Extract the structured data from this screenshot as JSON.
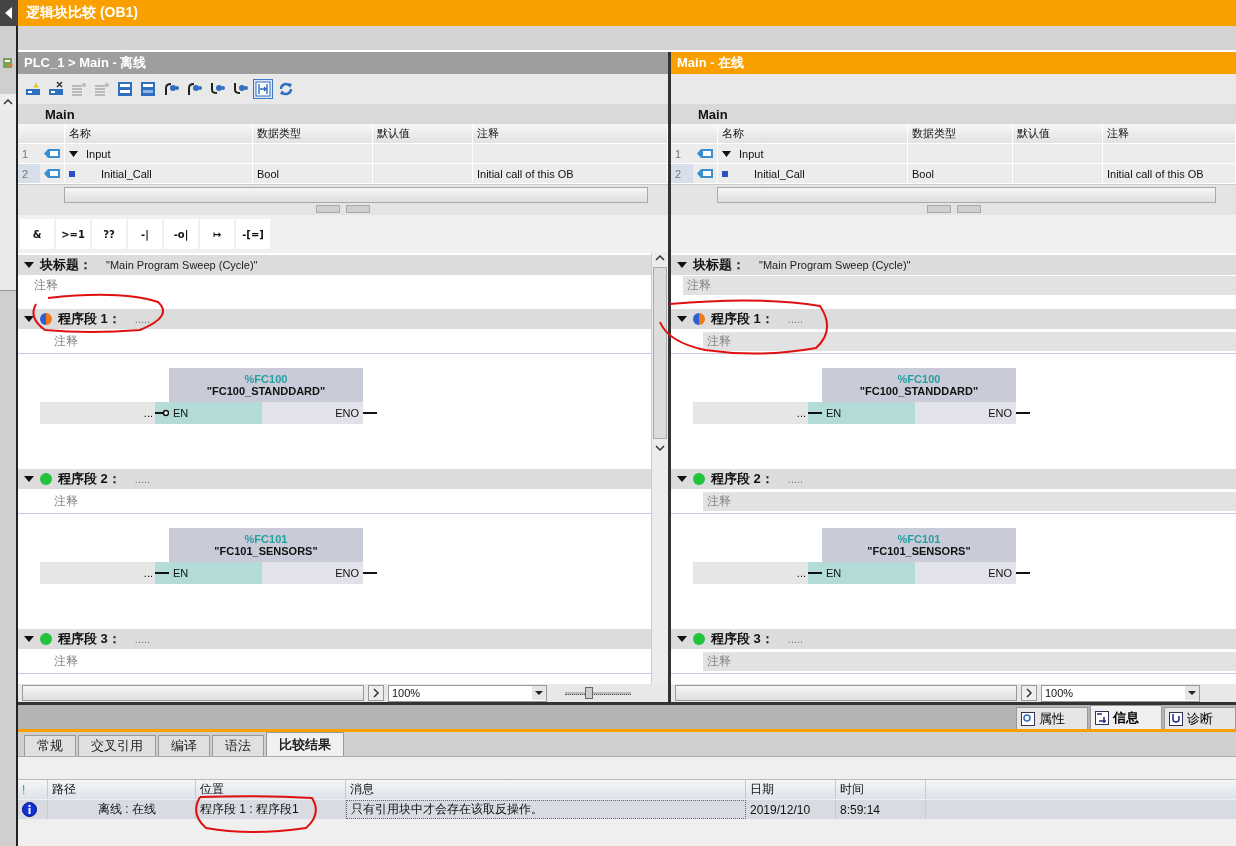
{
  "window": {
    "title": "逻辑块比较 (OB1)"
  },
  "panes": [
    {
      "kind": "offline",
      "title": "PLC_1 > Main - 离线",
      "toolbar": true,
      "vscroll": true,
      "palette": [
        "&",
        ">=1",
        "??",
        "-|",
        "-o|",
        "↦",
        "-[=]"
      ],
      "interface": {
        "name": "Main",
        "columns": [
          "名称",
          "数据类型",
          "默认值",
          "注释"
        ],
        "rows": [
          {
            "index": "1",
            "name": "Input",
            "expanded": true,
            "children": [
              {
                "index": "2",
                "name": "Initial_Call",
                "data_type": "Bool",
                "comment": "Initial call of this OB"
              }
            ]
          }
        ]
      },
      "block_title": {
        "label": "块标题：",
        "value": "\"Main Program Sweep (Cycle)\"",
        "comment": "注释"
      },
      "networks": [
        {
          "label": "程序段 1：",
          "title": ".....",
          "identical": false,
          "comment": "注释",
          "block": {
            "address": "%FC100",
            "name": "\"FC100_STANDDARD\"",
            "wire": "...",
            "input": "EN",
            "output": "ENO",
            "negated": true
          }
        },
        {
          "label": "程序段 2：",
          "title": ".....",
          "identical": true,
          "comment": "注释",
          "block": {
            "address": "%FC101",
            "name": "\"FC101_SENSORS\"",
            "wire": "...",
            "input": "EN",
            "output": "ENO",
            "negated": false
          }
        },
        {
          "label": "程序段 3：",
          "title": ".....",
          "identical": true,
          "comment": "注释"
        }
      ],
      "zoom": "100%",
      "zoom_slider": {
        "level": 0.35
      }
    },
    {
      "kind": "online",
      "title": "Main - 在线",
      "toolbar": false,
      "vscroll": false,
      "interface": {
        "name": "Main",
        "columns": [
          "名称",
          "数据类型",
          "默认值",
          "注释"
        ],
        "rows": [
          {
            "index": "1",
            "name": "Input",
            "expanded": true,
            "children": [
              {
                "index": "2",
                "name": "Initial_Call",
                "data_type": "Bool",
                "comment": "Initial call of this OB"
              }
            ]
          }
        ]
      },
      "block_title": {
        "label": "块标题：",
        "value": "\"Main Program Sweep (Cycle)\"",
        "comment": "注释"
      },
      "networks": [
        {
          "label": "程序段 1：",
          "title": ".....",
          "identical": false,
          "comment": "注释",
          "block": {
            "address": "%FC100",
            "name": "\"FC100_STANDDARD\"",
            "wire": "...",
            "input": "EN",
            "output": "ENO",
            "negated": false
          }
        },
        {
          "label": "程序段 2：",
          "title": ".....",
          "identical": true,
          "comment": "注释",
          "block": {
            "address": "%FC101",
            "name": "\"FC101_SENSORS\"",
            "wire": "...",
            "input": "EN",
            "output": "ENO",
            "negated": false
          }
        },
        {
          "label": "程序段 3：",
          "title": ".....",
          "identical": true,
          "comment": "注释"
        }
      ],
      "zoom": "100%"
    }
  ],
  "inspector": {
    "tabs": [
      {
        "label": "属性",
        "selected": false
      },
      {
        "label": "信息",
        "selected": true
      },
      {
        "label": "诊断",
        "selected": false
      }
    ],
    "subtabs": [
      {
        "label": "常规",
        "selected": false
      },
      {
        "label": "交叉引用",
        "selected": false
      },
      {
        "label": "编译",
        "selected": false
      },
      {
        "label": "语法",
        "selected": false
      },
      {
        "label": "比较结果",
        "selected": true
      }
    ],
    "messages": {
      "columns": [
        "!",
        "路径",
        "位置",
        "消息",
        "日期",
        "时间"
      ],
      "rows": [
        {
          "kind": "info",
          "path": "离线 : 在线",
          "location": "程序段 1 : 程序段1",
          "message": "只有引用块中才会存在该取反操作。",
          "date": "2019/12/10",
          "time": "8:59:14"
        }
      ]
    }
  }
}
